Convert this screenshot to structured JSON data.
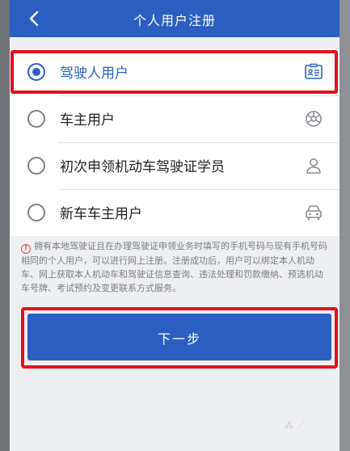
{
  "header": {
    "title": "个人用户注册",
    "back_icon": "chevron-left-icon"
  },
  "options": [
    {
      "label": "驾驶人用户",
      "selected": true,
      "icon": "id-card-icon"
    },
    {
      "label": "车主用户",
      "selected": false,
      "icon": "steering-wheel-icon"
    },
    {
      "label": "初次申领机动车驾驶证学员",
      "selected": false,
      "icon": "person-icon"
    },
    {
      "label": "新车车主用户",
      "selected": false,
      "icon": "car-icon"
    }
  ],
  "notice": {
    "icon": "warning-icon",
    "text": "拥有本地驾驶证且在办理驾驶证申领业务时填写的手机号码与现有手机号码相同的个人用户，可以进行网上注册。注册成功后，用户可以绑定本人机动车、网上获取本人机动车和驾驶证信息查询、违法处理和罚款缴纳、预选机动车号牌、考试预约及变更联系方式服务。"
  },
  "next_button": {
    "label": "下一步"
  },
  "colors": {
    "primary": "#2a5fc1",
    "highlight": "#e3101d"
  }
}
